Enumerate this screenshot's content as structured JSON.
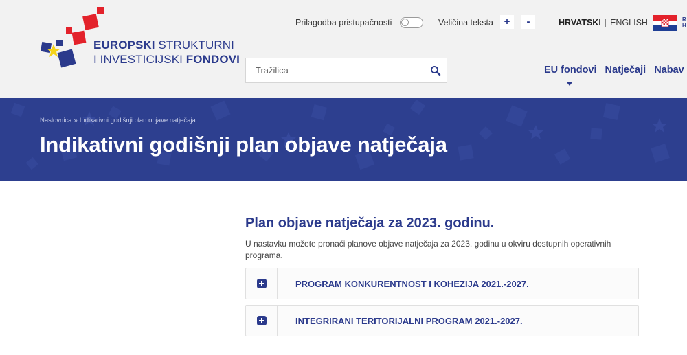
{
  "header": {
    "logo": {
      "line1_bold": "EUROPSKI",
      "line1_rest": " STRUKTURNI",
      "line2_rest": "I INVESTICIJSKI ",
      "line2_bold": "FONDOVI"
    },
    "accessibility_label": "Prilagodba pristupačnosti",
    "text_size_label": "Veličina teksta",
    "text_size_plus": "+",
    "text_size_minus": "-",
    "lang_active": "HRVATSKI",
    "lang_separator": "|",
    "lang_other": "ENGLISH",
    "flag_text_line1": "R",
    "flag_text_line2": "H",
    "search_placeholder": "Tražilica",
    "nav": [
      "EU fondovi",
      "Natječaji",
      "Nabav"
    ]
  },
  "banner": {
    "breadcrumb": [
      "Naslovnica",
      "»",
      "Indikativni godišnji plan objave natječaja"
    ],
    "title": "Indikativni godišnji plan objave natječaja"
  },
  "content": {
    "title": "Plan objave natječaja za 2023. godinu.",
    "description": "U nastavku možete pronaći planove objave natječaja za 2023. godinu u okviru dostupnih operativnih programa.",
    "accordion": [
      {
        "label": "PROGRAM KONKURENTNOST I KOHEZIJA 2021.-2027."
      },
      {
        "label": "INTEGRIRANI TERITORIJALNI PROGRAM 2021.-2027."
      }
    ]
  },
  "colors": {
    "brand": "#2b3a8c",
    "banner": "#2d3f8f",
    "header_bg": "#f2f2f2",
    "logo_red": "#e3222b",
    "logo_yellow": "#f5d31a"
  }
}
